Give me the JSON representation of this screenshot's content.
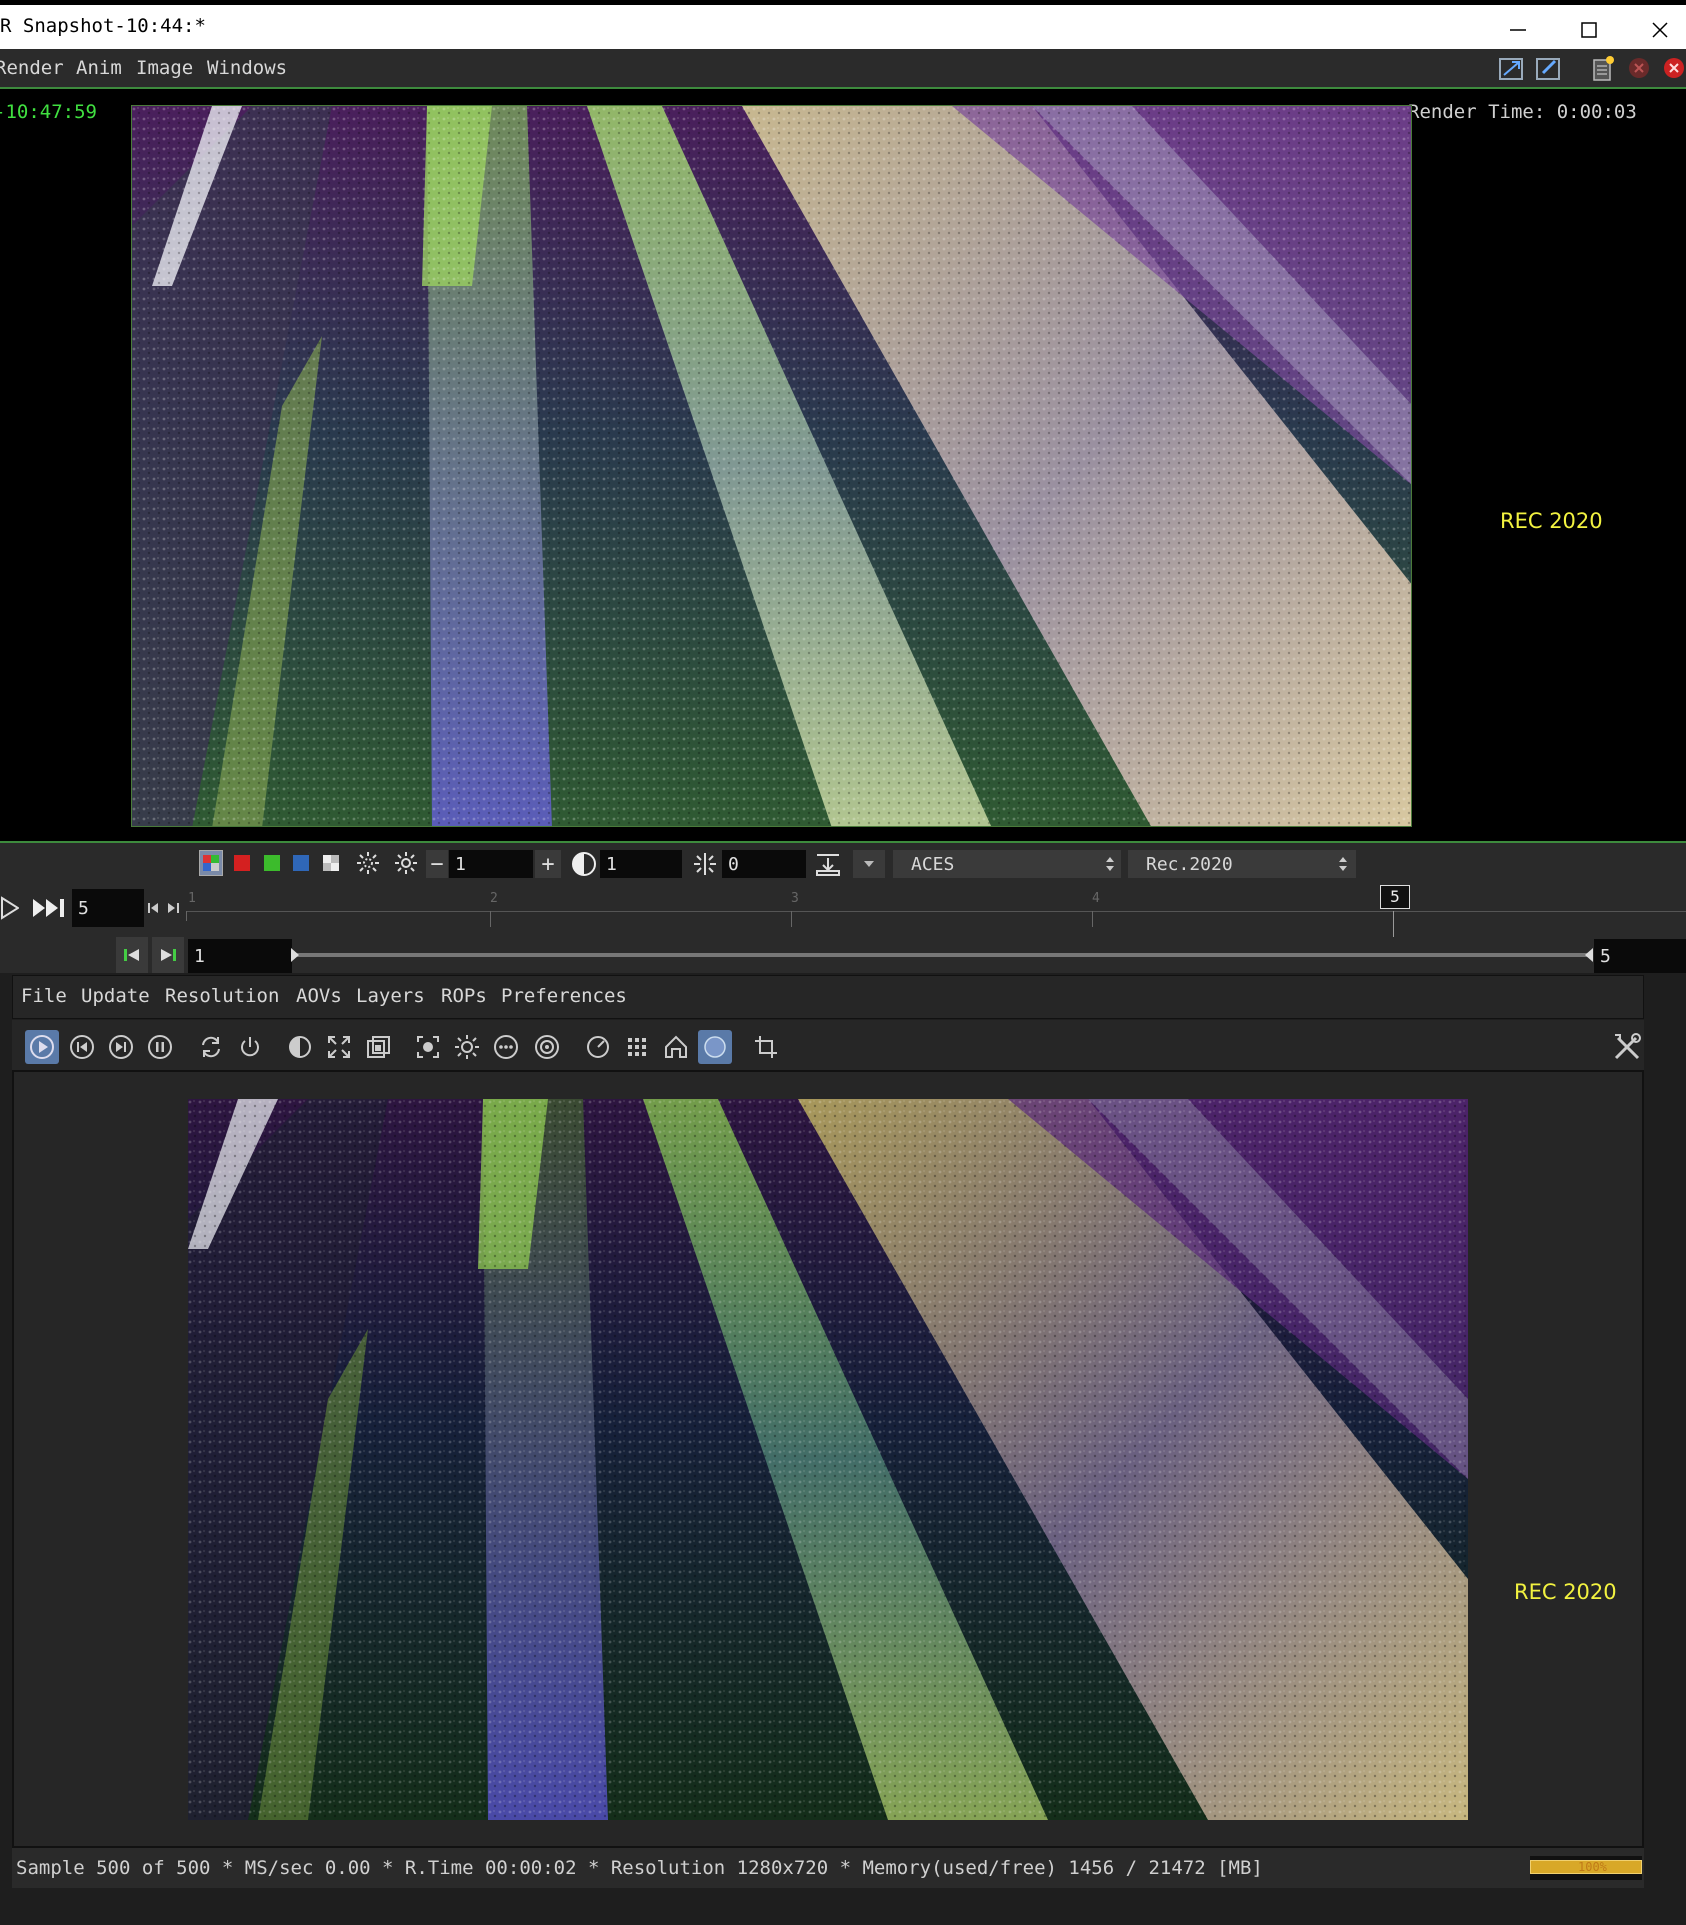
{
  "window": {
    "title": "R Snapshot-10:44:*",
    "controls": {
      "minimize": "—",
      "maximize": "☐",
      "close": "✕"
    }
  },
  "menubar": {
    "items": [
      "Render",
      "Anim",
      "Image",
      "Windows"
    ]
  },
  "top_viewer": {
    "timestamp": "-10:47:59",
    "render_time": "Render Time: 0:00:03",
    "color_space_label": "REC 2020"
  },
  "color_toolbar": {
    "exposure_value": "1",
    "gamma_value": "1",
    "offset_value": "0",
    "input_colorspace": "ACES",
    "display_colorspace": "Rec.2020",
    "minus_label": "−",
    "plus_label": "+"
  },
  "timeline": {
    "current_frame": "5",
    "ticks": [
      "1",
      "2",
      "3",
      "4"
    ],
    "marker_frame": "5"
  },
  "range": {
    "start": "1",
    "end": "5"
  },
  "panel": {
    "menu_items": [
      "File",
      "Update",
      "Resolution",
      "AOVs",
      "Layers",
      "ROPs",
      "Preferences"
    ],
    "color_space_label": "REC 2020"
  },
  "status": {
    "text": "Sample 500 of 500 * MS/sec 0.00 * R.Time 00:00:02 * Resolution 1280x720 * Memory(used/free) 1456 / 21472 [MB]",
    "progress_label": "100%",
    "progress_fraction": 1.0
  },
  "colors": {
    "accent_green": "#3d8a3d",
    "label_yellow": "#f2f240",
    "timestamp_green": "#40e040"
  }
}
